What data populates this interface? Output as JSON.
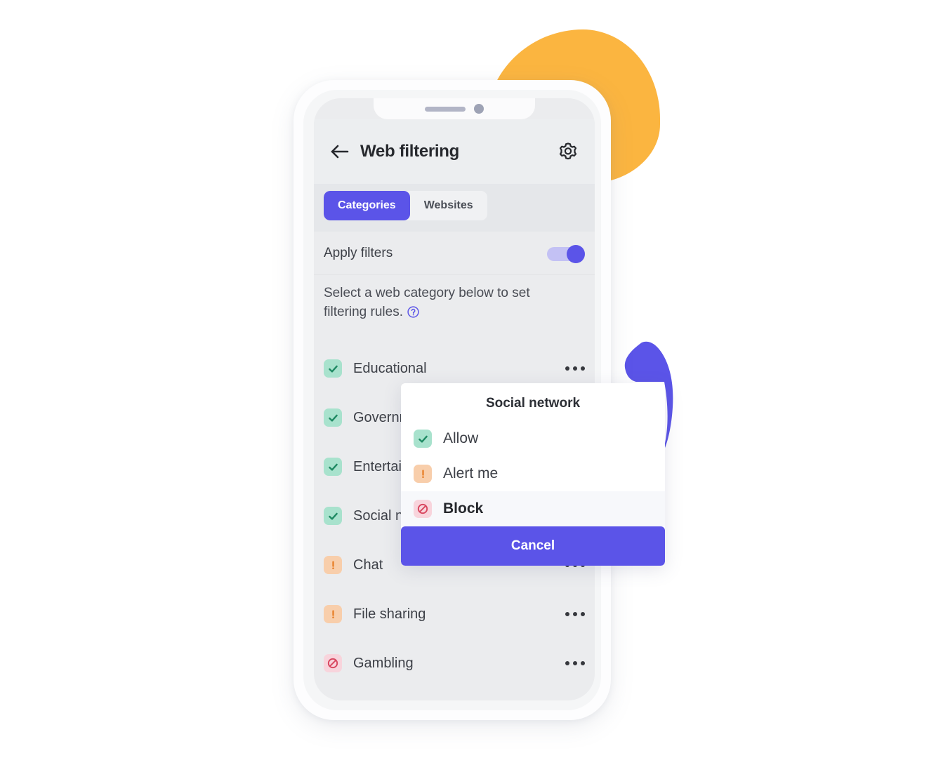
{
  "theme": {
    "accent": "#5b54e8",
    "accent_light": "#c3c1f4",
    "orange_blob": "#fbb540",
    "purple_blob": "#5b54e8",
    "allow_badge": "#a8e2cd",
    "alert_badge": "#f8ceab",
    "block_badge": "#f8d4dc",
    "screen_bg": "#ebecee",
    "text": "#3d4047"
  },
  "header": {
    "back_icon": "arrow-left-icon",
    "title": "Web filtering",
    "settings_icon": "gear-icon"
  },
  "tabs": [
    {
      "label": "Categories",
      "active": true
    },
    {
      "label": "Websites",
      "active": false
    }
  ],
  "apply_filters": {
    "label": "Apply filters",
    "enabled": true
  },
  "description": {
    "text": "Select a web category below to set filtering rules.",
    "help_icon": "question-circle-icon"
  },
  "categories": [
    {
      "name": "Educational",
      "status": "allow",
      "icon": "check-icon",
      "more_icon": "more-horizontal-icon"
    },
    {
      "name": "Government",
      "status": "allow",
      "icon": "check-icon",
      "more_icon": "more-horizontal-icon"
    },
    {
      "name": "Entertainment",
      "status": "allow",
      "icon": "check-icon",
      "more_icon": "more-horizontal-icon"
    },
    {
      "name": "Social network",
      "status": "allow",
      "icon": "check-icon",
      "more_icon": "more-horizontal-icon"
    },
    {
      "name": "Chat",
      "status": "alert",
      "icon": "alert-icon",
      "more_icon": "more-horizontal-icon"
    },
    {
      "name": "File sharing",
      "status": "alert",
      "icon": "alert-icon",
      "more_icon": "more-horizontal-icon"
    },
    {
      "name": "Gambling",
      "status": "block",
      "icon": "block-icon",
      "more_icon": "more-horizontal-icon"
    }
  ],
  "action_sheet": {
    "title": "Social network",
    "options": [
      {
        "label": "Allow",
        "status": "allow",
        "icon": "check-icon",
        "selected": false
      },
      {
        "label": "Alert me",
        "status": "alert",
        "icon": "alert-icon",
        "selected": false
      },
      {
        "label": "Block",
        "status": "block",
        "icon": "block-icon",
        "selected": true
      }
    ],
    "cancel_label": "Cancel"
  }
}
